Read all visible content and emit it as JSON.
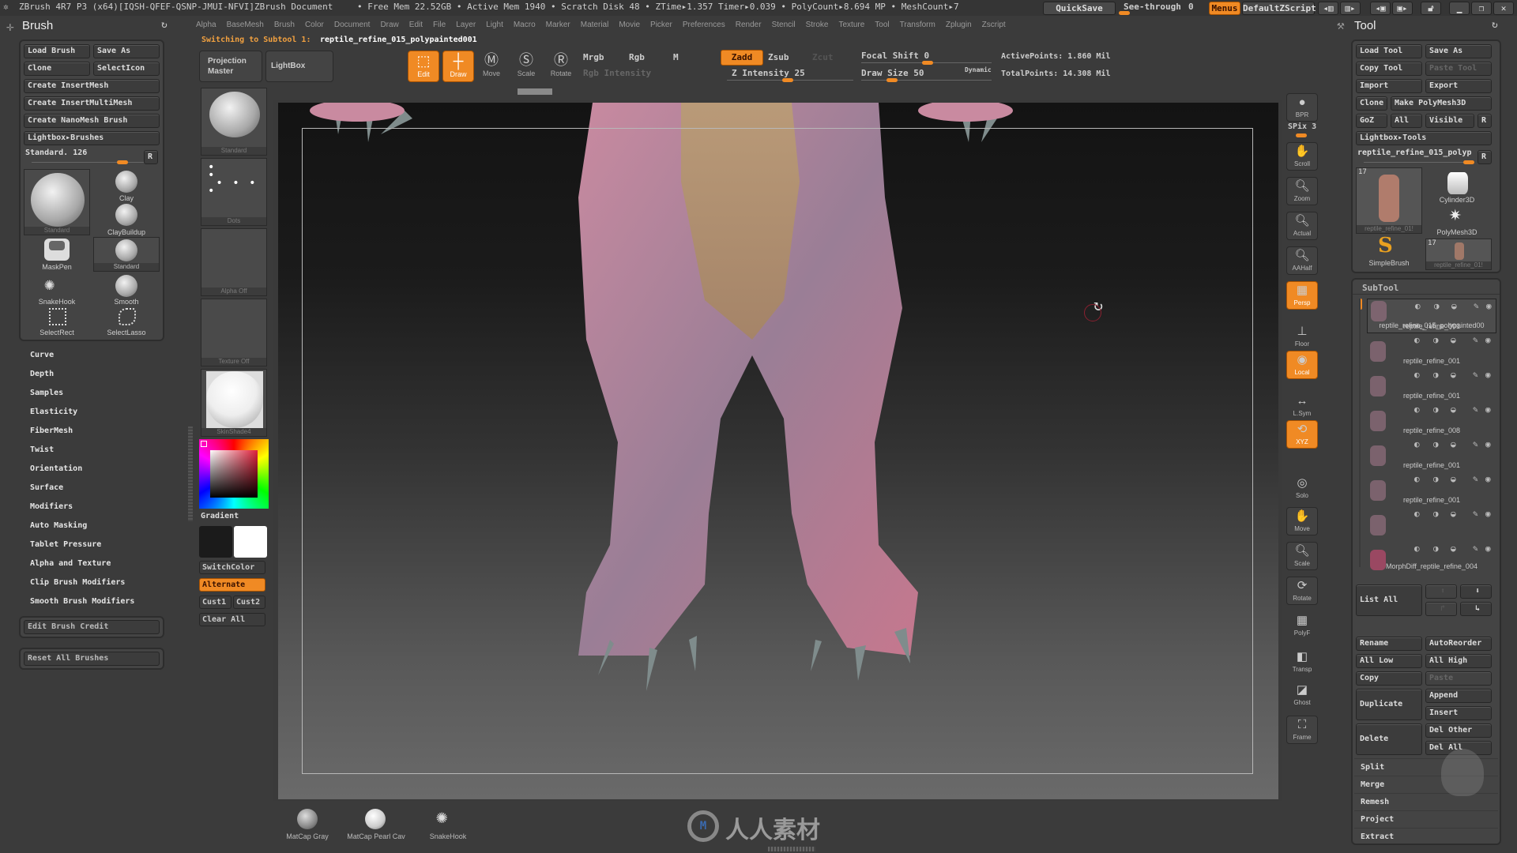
{
  "titlebar": {
    "app": "ZBrush 4R7 P3 (x64)[IQSH-QFEF-QSNP-JMUI-NFVI]",
    "document": "ZBrush Document",
    "stats": "• Free Mem 22.52GB • Active Mem 1940 • Scratch Disk 48 • ZTime▸1.357 Timer▸0.039 • PolyCount▸8.694 MP • MeshCount▸7",
    "quicksave": "QuickSave",
    "seethrough_label": "See-through",
    "seethrough_value": "0",
    "menus": "Menus",
    "script": "DefaultZScript"
  },
  "menubar": [
    "Alpha",
    "BaseMesh",
    "Brush",
    "Color",
    "Document",
    "Draw",
    "Edit",
    "File",
    "Layer",
    "Light",
    "Macro",
    "Marker",
    "Material",
    "Movie",
    "Picker",
    "Preferences",
    "Render",
    "Stencil",
    "Stroke",
    "Texture",
    "Tool",
    "Transform",
    "Zplugin",
    "Zscript"
  ],
  "notice": {
    "prefix": "Switching to Subtool 1:",
    "name": "reptile_refine_015_polypainted001"
  },
  "brush_panel": {
    "title": "Brush",
    "buttons": [
      "Load Brush",
      "Save As",
      "Clone",
      "SelectIcon",
      "Create InsertMesh",
      "Create InsertMultiMesh",
      "Create NanoMesh Brush",
      "Lightbox▸Brushes"
    ],
    "slider_label": "Standard. 126",
    "r": "R",
    "brushes": [
      "Standard",
      "Clay",
      "ClayBuildup",
      "MaskPen",
      "Standard",
      "SnakeHook",
      "Smooth",
      "SelectRect",
      "SelectLasso"
    ],
    "subpalettes": [
      "Curve",
      "Depth",
      "Samples",
      "Elasticity",
      "FiberMesh",
      "Twist",
      "Orientation",
      "Surface",
      "Modifiers",
      "Auto Masking",
      "Tablet Pressure",
      "Alpha and Texture",
      "Clip Brush Modifiers",
      "Smooth Brush Modifiers"
    ],
    "edit_credit": "Edit Brush Credit",
    "reset_all": "Reset All Brushes"
  },
  "left_shelf": {
    "projection_master": "Projection Master",
    "lightbox": "LightBox",
    "thumbs": [
      "Standard",
      "Dots",
      "Alpha Off",
      "Texture Off",
      "SkinShade4"
    ],
    "gradient": "Gradient",
    "switchcolor": "SwitchColor",
    "alternate": "Alternate",
    "cust1": "Cust1",
    "cust2": "Cust2",
    "clear_all": "Clear All",
    "main_color": "#1b1b1b",
    "secondary_color": "#ffffff"
  },
  "toolbar": {
    "modes": [
      {
        "label": "Edit",
        "active": true
      },
      {
        "label": "Draw",
        "active": true
      },
      {
        "label": "Move",
        "active": false
      },
      {
        "label": "Scale",
        "active": false
      },
      {
        "label": "Rotate",
        "active": false
      }
    ],
    "mrgb": "Mrgb",
    "rgb": "Rgb",
    "m": "M",
    "rgb_intensity": "Rgb Intensity",
    "zadd": "Zadd",
    "zsub": "Zsub",
    "zcut": "Zcut",
    "z_intensity": "Z Intensity 25",
    "focal_shift": "Focal Shift 0",
    "draw_size": "Draw Size 50",
    "dynamic": "Dynamic",
    "active_points": "ActivePoints: 1.860 Mil",
    "total_points": "TotalPoints: 14.308 Mil"
  },
  "right_shelf": [
    {
      "label": "BPR",
      "state": "normal"
    },
    {
      "label": "SPix 3",
      "state": "slider"
    },
    {
      "label": "Scroll",
      "state": "normal"
    },
    {
      "label": "Zoom",
      "state": "normal"
    },
    {
      "label": "Actual",
      "state": "normal"
    },
    {
      "label": "AAHalf",
      "state": "normal"
    },
    {
      "label": "Persp",
      "state": "on"
    },
    {
      "label": "Floor",
      "state": "flat"
    },
    {
      "label": "Local",
      "state": "on"
    },
    {
      "label": "L.Sym",
      "state": "flat"
    },
    {
      "label": "XYZ",
      "state": "on"
    },
    {
      "label": "Solo",
      "state": "flat"
    },
    {
      "label": "Move",
      "state": "normal"
    },
    {
      "label": "Scale",
      "state": "normal"
    },
    {
      "label": "Rotate",
      "state": "normal"
    },
    {
      "label": "PolyF",
      "state": "flat"
    },
    {
      "label": "Transp",
      "state": "flat"
    },
    {
      "label": "Ghost",
      "state": "flat"
    },
    {
      "label": "Frame",
      "state": "normal"
    }
  ],
  "tool_panel": {
    "title": "Tool",
    "buttons": [
      "Load Tool",
      "Save As",
      "Copy Tool",
      "Paste Tool",
      "Import",
      "Export",
      "Clone",
      "Make PolyMesh3D",
      "GoZ",
      "All",
      "Visible",
      "R",
      "Lightbox▸Tools"
    ],
    "current_tool": "reptile_refine_015_polyp",
    "r": "R",
    "tools": [
      {
        "name": "reptile_refine_01!",
        "count": "17"
      },
      {
        "name": "Cylinder3D"
      },
      {
        "name": "PolyMesh3D"
      },
      {
        "name": "SimpleBrush"
      },
      {
        "name": "reptile_refine_01!",
        "count": "17"
      }
    ]
  },
  "subtool": {
    "title": "SubTool",
    "items": [
      "reptile_refine_015_polypainted00",
      "reptile_refine_001",
      "reptile_refine_001",
      "reptile_refine_001",
      "reptile_refine_008",
      "reptile_refine_001",
      "reptile_refine_001",
      "MorphDiff_reptile_refine_004"
    ],
    "list_all": "List All",
    "rename": "Rename",
    "autoreorder": "AutoReorder",
    "all_low": "All Low",
    "all_high": "All High",
    "copy": "Copy",
    "paste": "Paste",
    "duplicate": "Duplicate",
    "append": "Append",
    "insert": "Insert",
    "delete": "Delete",
    "del_other": "Del Other",
    "del_all": "Del All",
    "subpalettes": [
      "Split",
      "Merge",
      "Remesh",
      "Project",
      "Extract"
    ]
  },
  "bottom_shelf": {
    "materials": [
      "MatCap Gray",
      "MatCap Pearl Cav",
      "SnakeHook"
    ],
    "watermark": "人人素材"
  },
  "colors": {
    "accent": "#f08a24",
    "panel": "#444444",
    "background": "#3b3b3b"
  }
}
